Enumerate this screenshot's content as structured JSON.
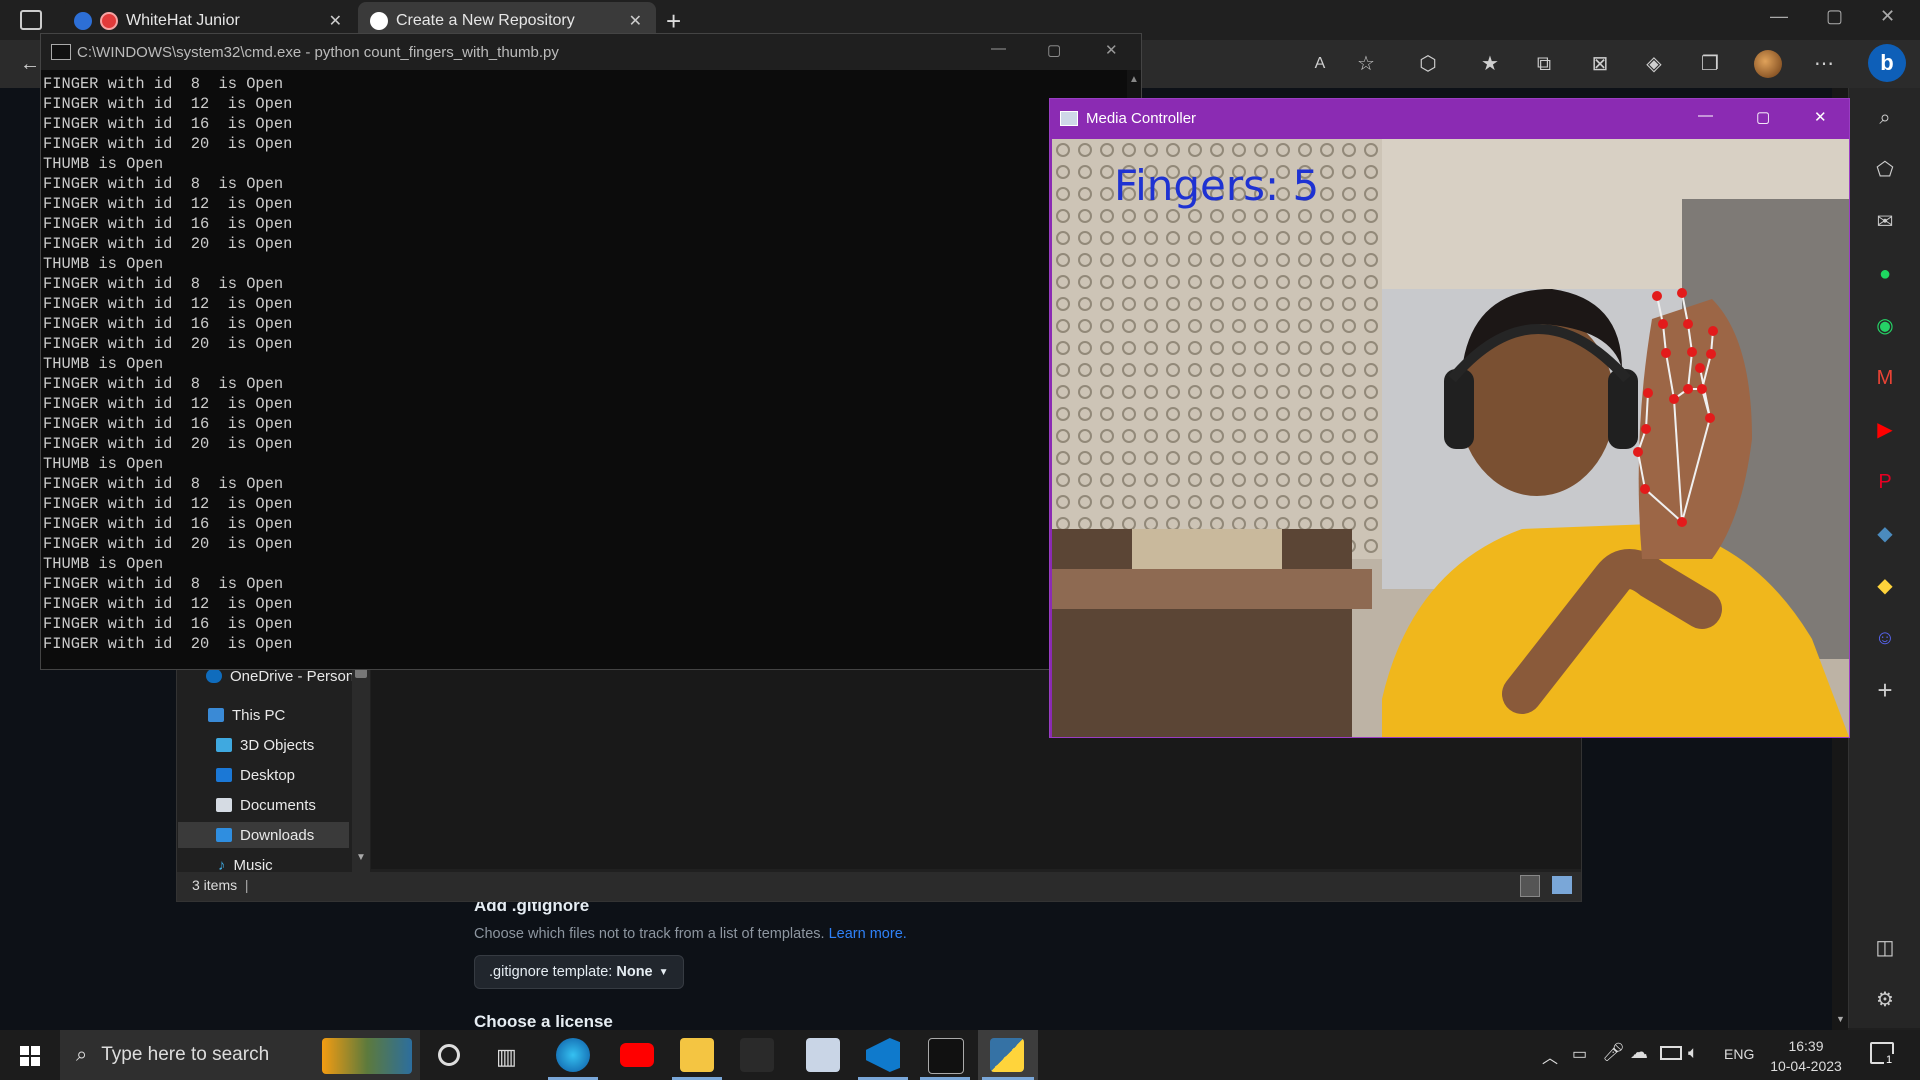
{
  "browser": {
    "tabs": [
      {
        "title": "WhiteHat Junior",
        "active": false
      },
      {
        "title": "Create a New Repository",
        "active": true
      }
    ]
  },
  "github": {
    "gitignore_heading": "Add .gitignore",
    "gitignore_desc": "Choose which files not to track from a list of templates.",
    "learn_more": "Learn more.",
    "gitignore_template_label": ".gitignore template:",
    "gitignore_template_value": "None",
    "license_heading": "Choose a license"
  },
  "explorer": {
    "nav": [
      {
        "label": "OneDrive - Person"
      },
      {
        "label": "This PC"
      },
      {
        "label": "3D Objects"
      },
      {
        "label": "Desktop"
      },
      {
        "label": "Documents"
      },
      {
        "label": "Downloads"
      },
      {
        "label": "Music"
      }
    ],
    "status": "3 items"
  },
  "cmd": {
    "title": "C:\\WINDOWS\\system32\\cmd.exe - python  count_fingers_with_thumb.py",
    "lines": [
      "FINGER with id  8  is Open",
      "FINGER with id  12  is Open",
      "FINGER with id  16  is Open",
      "FINGER with id  20  is Open",
      "THUMB is Open",
      "FINGER with id  8  is Open",
      "FINGER with id  12  is Open",
      "FINGER with id  16  is Open",
      "FINGER with id  20  is Open",
      "THUMB is Open",
      "FINGER with id  8  is Open",
      "FINGER with id  12  is Open",
      "FINGER with id  16  is Open",
      "FINGER with id  20  is Open",
      "THUMB is Open",
      "FINGER with id  8  is Open",
      "FINGER with id  12  is Open",
      "FINGER with id  16  is Open",
      "FINGER with id  20  is Open",
      "THUMB is Open",
      "FINGER with id  8  is Open",
      "FINGER with id  12  is Open",
      "FINGER with id  16  is Open",
      "FINGER with id  20  is Open",
      "THUMB is Open",
      "FINGER with id  8  is Open",
      "FINGER with id  12  is Open",
      "FINGER with id  16  is Open",
      "FINGER with id  20  is Open"
    ]
  },
  "media": {
    "title": "Media Controller",
    "overlay": "Fingers: 5"
  },
  "taskbar": {
    "search_placeholder": "Type here to search",
    "language": "ENG",
    "time": "16:39",
    "date": "10-04-2023",
    "notifications": "1"
  },
  "colors": {
    "media_titlebar": "#8b2bb3",
    "overlay_text": "#1e32d2",
    "landmark": "#e31b1b",
    "link": "#2f81f7"
  }
}
